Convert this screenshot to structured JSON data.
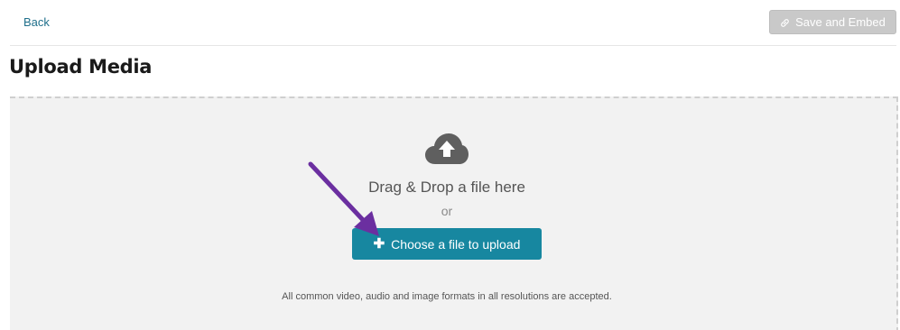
{
  "header": {
    "back_label": "Back",
    "save_label": "Save and Embed"
  },
  "page": {
    "title": "Upload Media"
  },
  "dropzone": {
    "drag_text": "Drag & Drop a file here",
    "or_text": "or",
    "choose_label": "Choose a file to upload",
    "formats_text": "All common video, audio and image formats in all resolutions are accepted."
  },
  "icons": {
    "save": "link-icon",
    "upload": "cloud-upload-icon",
    "choose": "plus-icon",
    "annotation": "purple-arrow-icon"
  },
  "colors": {
    "accent": "#1787a0",
    "link": "#1f6f8b",
    "disabled_button": "#c9c9c9",
    "annotation": "#6b2fa0"
  }
}
